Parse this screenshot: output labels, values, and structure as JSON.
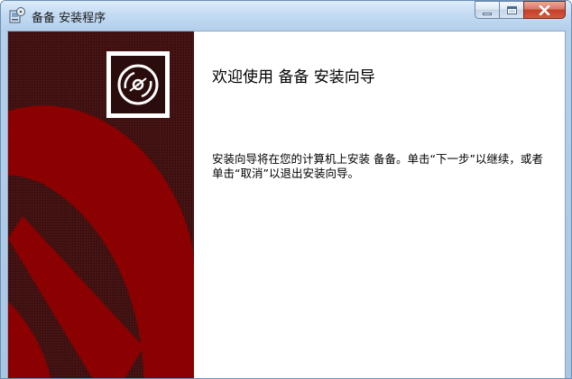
{
  "window": {
    "title": "备备 安装程序",
    "icons": {
      "app": "installer-app-icon",
      "minimize": "minimize-icon",
      "maximize": "maximize-icon",
      "close": "close-icon"
    }
  },
  "wizard": {
    "banner_icon": "cd-disc-icon",
    "heading": "欢迎使用 备备 安装向导",
    "description": "安装向导将在您的计算机上安装 备备。单击“下一步”以继续，或者单击“取消”以退出安装向导。"
  },
  "colors": {
    "banner_dark": "#3a1010",
    "banner_red": "#8b0000",
    "titlebar": "#c4dbf2",
    "close_button": "#c4402a"
  }
}
